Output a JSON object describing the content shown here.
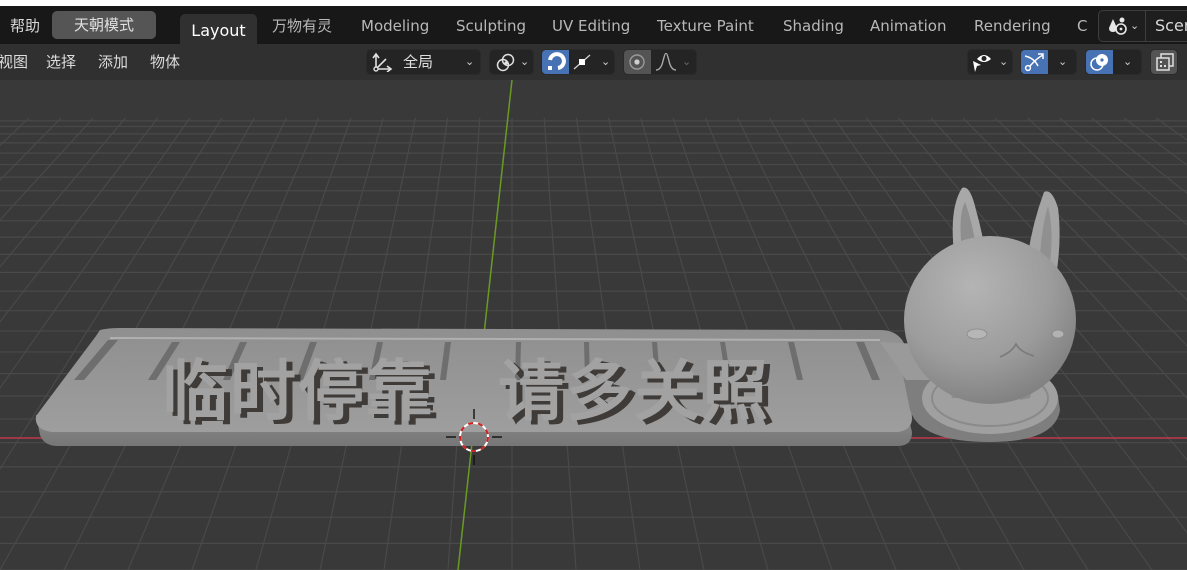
{
  "topbar": {
    "menu_help": "帮助",
    "mode_button": "天朝模式",
    "workspace_tabs": [
      "Layout",
      "万物有灵",
      "Modeling",
      "Sculpting",
      "UV Editing",
      "Texture Paint",
      "Shading",
      "Animation",
      "Rendering",
      "C"
    ],
    "active_tab": "Layout",
    "scene_label": "Scer"
  },
  "header": {
    "menus": [
      "视图",
      "选择",
      "添加",
      "物体"
    ],
    "transform_orientation": "全局",
    "snap_enabled": true,
    "proportional_editing_enabled": false,
    "gizmo_enabled": true,
    "overlays_enabled": true
  },
  "viewport": {
    "model_text": "临时停靠  请多关照",
    "model_text_left": "临时停靠",
    "model_text_right": "请多关照",
    "colors": {
      "background": "#393939",
      "grid": "#4a4a4a",
      "x_axis": "#c0394b",
      "y_axis": "#6a9a23",
      "model": "#9a9a9a",
      "accent": "#4772b3"
    }
  }
}
